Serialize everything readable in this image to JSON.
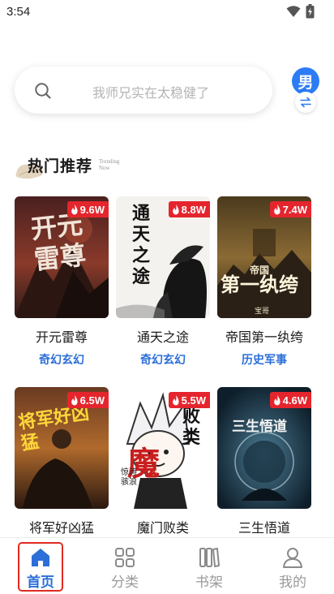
{
  "status_bar": {
    "time": "3:54"
  },
  "search": {
    "placeholder": "我师兄实在太稳健了",
    "icon": "search-icon"
  },
  "gender_toggle": {
    "label": "男"
  },
  "section": {
    "title": "热门推荐",
    "subtitle_line1": "Trending",
    "subtitle_line2": "Now"
  },
  "books": [
    {
      "title": "开元雷尊",
      "genre": "奇幻玄幻",
      "heat": "9.6W"
    },
    {
      "title": "通天之途",
      "genre": "奇幻玄幻",
      "heat": "8.8W"
    },
    {
      "title": "帝国第一纨绔",
      "genre": "历史军事",
      "heat": "7.4W"
    },
    {
      "title": "将军好凶猛",
      "genre": "",
      "heat": "6.5W"
    },
    {
      "title": "魔门败类",
      "genre": "",
      "heat": "5.5W"
    },
    {
      "title": "三生悟道",
      "genre": "",
      "heat": "4.6W"
    }
  ],
  "covers": {
    "c1": "开元雷尊",
    "c2": "通天之途",
    "c3_top": "帝国",
    "c3_main": "第一纨绔",
    "c3_author": "宝哥",
    "c4": "将军好凶猛",
    "c5_main": "魔",
    "c5_side": "败类",
    "c5_author": "惊涛骇浪",
    "c6": "三生悟道"
  },
  "tabs": [
    {
      "label": "首页",
      "icon": "home-icon",
      "active": true
    },
    {
      "label": "分类",
      "icon": "grid-icon",
      "active": false
    },
    {
      "label": "书架",
      "icon": "bookshelf-icon",
      "active": false
    },
    {
      "label": "我的",
      "icon": "user-icon",
      "active": false
    }
  ],
  "colors": {
    "accent": "#2d6fd8",
    "badge": "#e5252d",
    "highlight": "#e02a20"
  }
}
